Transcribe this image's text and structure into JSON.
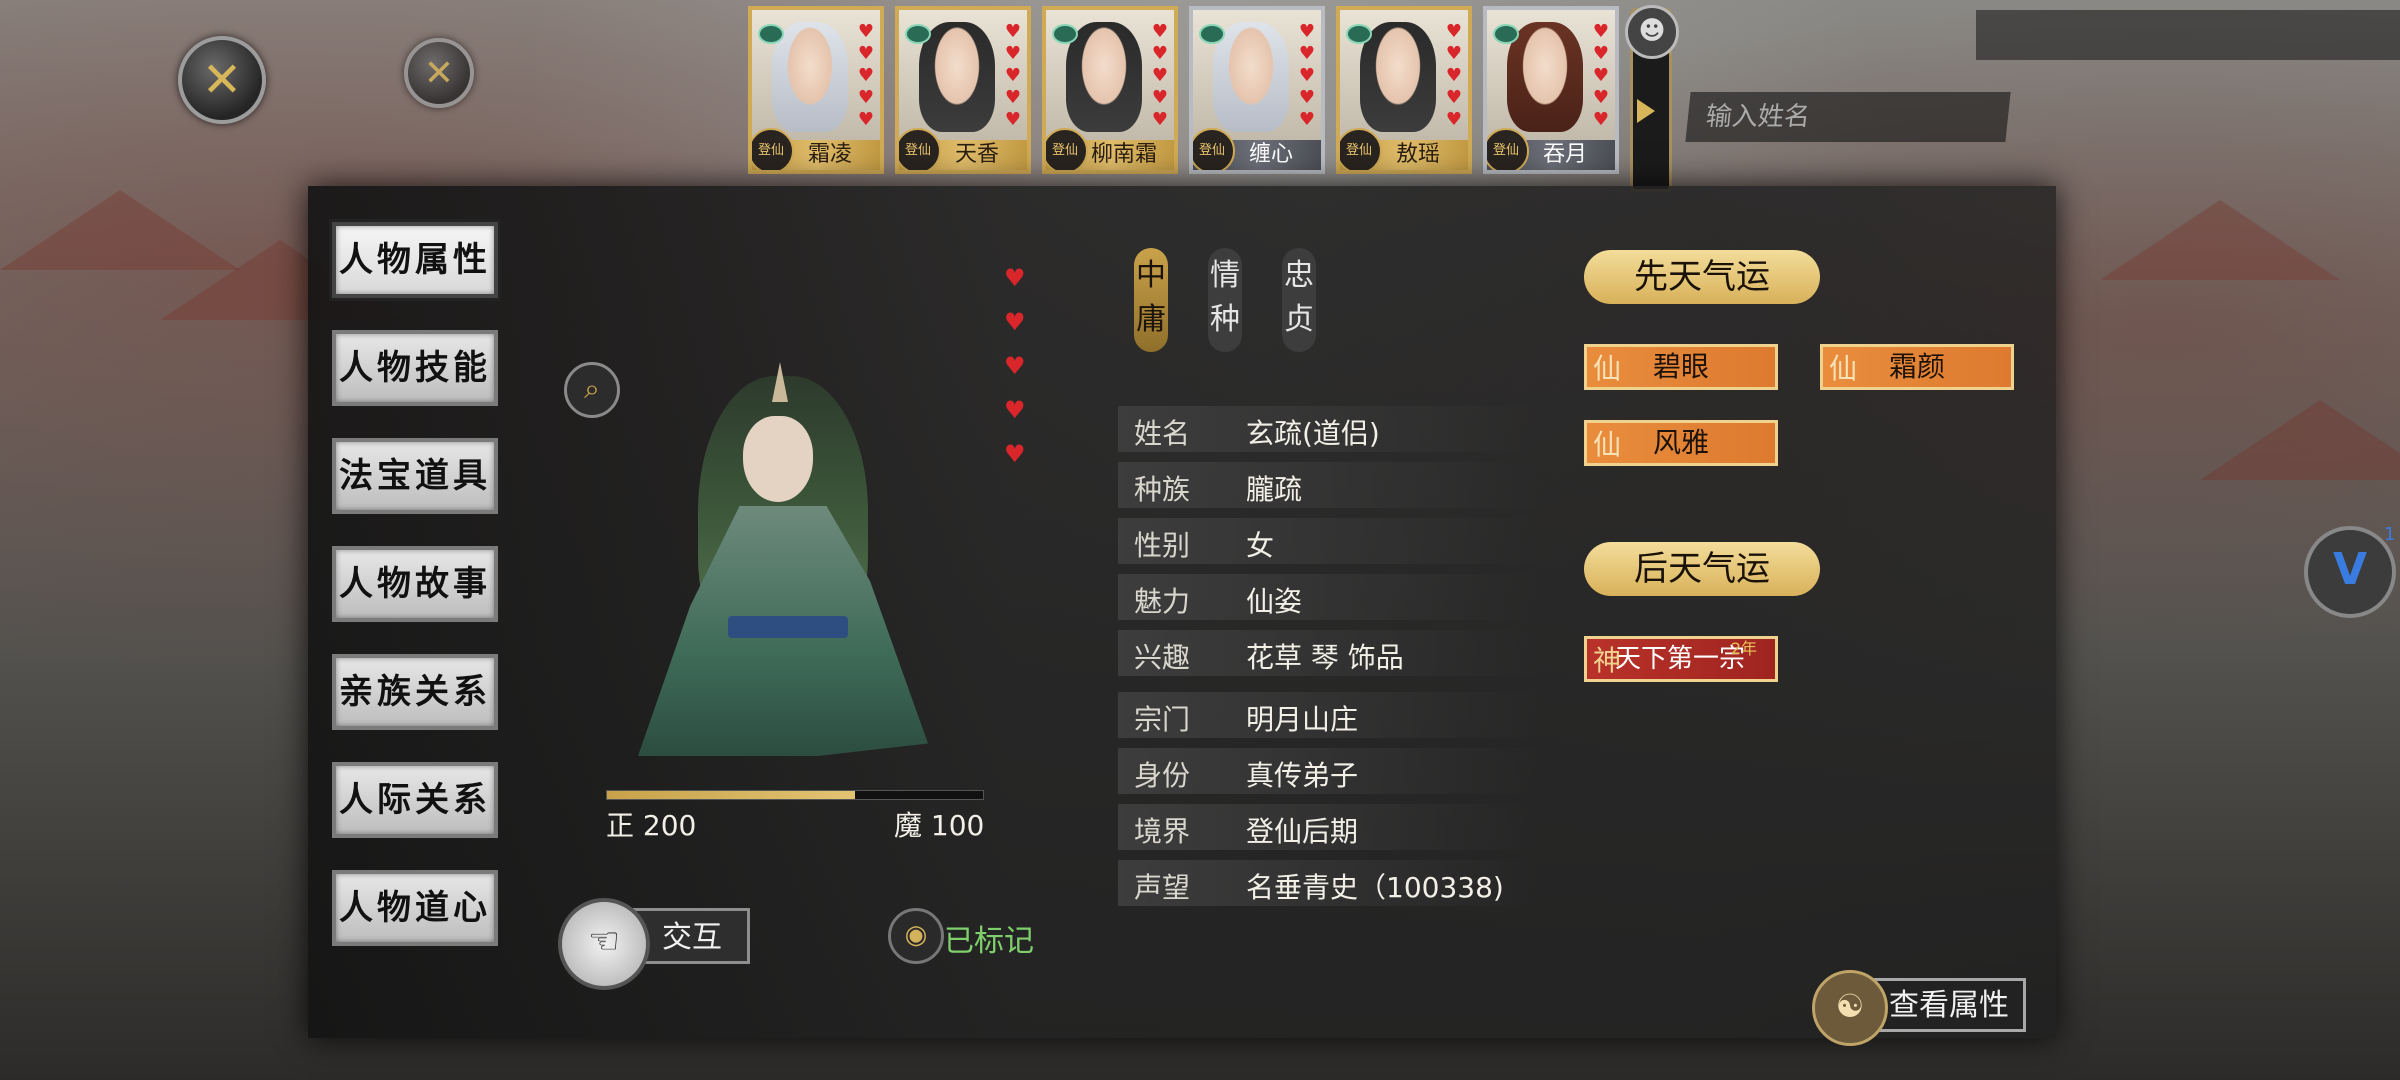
{
  "top_buttons": {
    "close_primary": "✕",
    "close_secondary": "✕"
  },
  "background": {
    "name_input_placeholder": "输入姓名"
  },
  "portraits": [
    {
      "name": "霜凌",
      "badge": "登仙",
      "hearts": 5,
      "frame": "gold",
      "hair": "light"
    },
    {
      "name": "天香",
      "badge": "登仙",
      "hearts": 5,
      "frame": "gold",
      "hair": "dark"
    },
    {
      "name": "柳南霜",
      "badge": "登仙",
      "hearts": 5,
      "frame": "gold",
      "hair": "dark"
    },
    {
      "name": "缠心",
      "badge": "登仙",
      "hearts": 5,
      "frame": "silver",
      "hair": "light"
    },
    {
      "name": "敖瑶",
      "badge": "登仙",
      "hearts": 5,
      "frame": "gold",
      "hair": "dark"
    },
    {
      "name": "吞月",
      "badge": "登仙",
      "hearts": 5,
      "frame": "silver",
      "hair": "brown"
    }
  ],
  "menu": [
    {
      "label": "人物属性",
      "active": true
    },
    {
      "label": "人物技能",
      "active": false
    },
    {
      "label": "法宝道具",
      "active": false
    },
    {
      "label": "人物故事",
      "active": false
    },
    {
      "label": "亲族关系",
      "active": false
    },
    {
      "label": "人际关系",
      "active": false
    },
    {
      "label": "人物道心",
      "active": false
    }
  ],
  "character": {
    "hearts": 5,
    "righteous_label": "正 200",
    "demonic_label": "魔 100",
    "alignment_fill_fraction": 0.66,
    "interact_label": "交互",
    "marked_label": "已标记"
  },
  "tags": [
    {
      "line1": "中",
      "line2": "庸",
      "active": true
    },
    {
      "line1": "情",
      "line2": "种",
      "active": false
    },
    {
      "line1": "忠",
      "line2": "贞",
      "active": false
    }
  ],
  "info": {
    "basic": [
      {
        "key": "姓名",
        "value": "玄疏(道侣)"
      },
      {
        "key": "种族",
        "value": "朧疏"
      },
      {
        "key": "性别",
        "value": "女"
      },
      {
        "key": "魅力",
        "value": "仙姿"
      },
      {
        "key": "兴趣",
        "value": "花草  琴      饰品"
      }
    ],
    "sect": [
      {
        "key": "宗门",
        "value": "明月山庄"
      },
      {
        "key": "身份",
        "value": "真传弟子"
      },
      {
        "key": "境界",
        "value": "登仙后期"
      },
      {
        "key": "声望",
        "value": "名垂青史（100338)"
      }
    ]
  },
  "innate_fortune": {
    "title": "先天气运",
    "items": [
      {
        "icon": "仙",
        "label": "碧眼"
      },
      {
        "icon": "仙",
        "label": "霜颜"
      },
      {
        "icon": "仙",
        "label": "风雅"
      }
    ]
  },
  "acquired_fortune": {
    "title": "后天气运",
    "items": [
      {
        "icon": "神",
        "label": "天下第一宗",
        "note": "2年"
      }
    ]
  },
  "view_attributes": "查看属性",
  "float_badge_count": "1",
  "colors": {
    "accent_gold": "#d8b15a",
    "luck_orange": "#e98d3d",
    "luck_red": "#b9322a",
    "heart_red": "#d9262a",
    "marked_green": "#7fd06c"
  }
}
